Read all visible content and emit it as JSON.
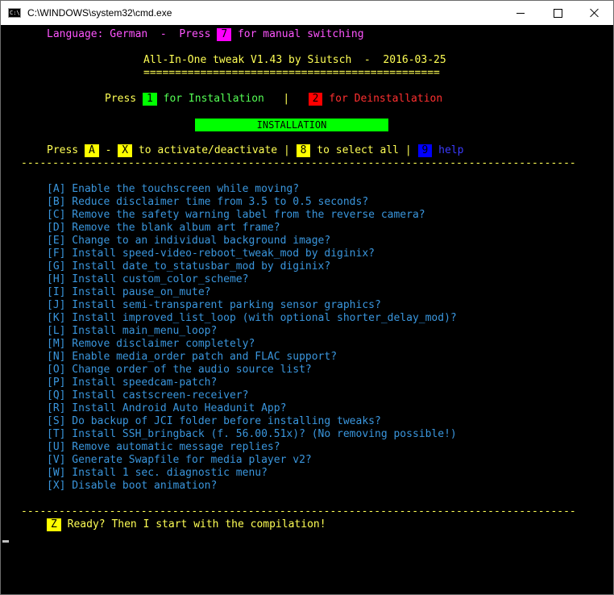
{
  "window": {
    "title": "C:\\WINDOWS\\system32\\cmd.exe",
    "icon_text": "C:\\"
  },
  "header": {
    "lang_prefix": "Language: German  -  Press ",
    "lang_key": "7",
    "lang_suffix": " for manual switching",
    "title": "All-In-One tweak V1.43 by Siutsch  -  2016-03-25",
    "underline": "==============================================="
  },
  "mode": {
    "press": "Press ",
    "install_key": "1",
    "install_label": " for Installation",
    "divider": "   |   ",
    "deinstall_key": "2",
    "deinstall_label": " for Deinstallation",
    "banner": "INSTALLATION"
  },
  "controls": {
    "press": "Press ",
    "key_a": "A",
    "dash": " - ",
    "key_x": "X",
    "activate_label": " to activate/deactivate ",
    "bar": "|",
    "key_8": "8",
    "select_all_label": " to select all ",
    "key_9": "9",
    "help_label": " help"
  },
  "separator": "----------------------------------------------------------------------------------------",
  "options": [
    "[A] Enable the touchscreen while moving?",
    "[B] Reduce disclaimer time from 3.5 to 0.5 seconds?",
    "[C] Remove the safety warning label from the reverse camera?",
    "[D] Remove the blank album art frame?",
    "[E] Change to an individual background image?",
    "[F] Install speed-video-reboot_tweak_mod by diginix?",
    "[G] Install date_to_statusbar_mod by diginix?",
    "[H] Install custom_color_scheme?",
    "[I] Install pause_on_mute?",
    "[J] Install semi-transparent parking sensor graphics?",
    "[K] Install improved_list_loop (with optional shorter_delay_mod)?",
    "[L] Install main_menu_loop?",
    "[M] Remove disclaimer completely?",
    "[N] Enable media_order patch and FLAC support?",
    "[O] Change order of the audio source list?",
    "[P] Install speedcam-patch?",
    "[Q] Install castscreen-receiver?",
    "[R] Install Android Auto Headunit App?",
    "[S] Do backup of JCI folder before installing tweaks?",
    "[T] Install SSH_bringback (f. 56.00.51x)? (No removing possible!)",
    "[U] Remove automatic message replies?",
    "[V] Generate Swapfile for media player v2?",
    "[W] Install 1 sec. diagnostic menu?",
    "[X] Disable boot animation?"
  ],
  "footer": {
    "key_z": "Z",
    "ready_text": " Ready? Then I start with the compilation!"
  },
  "colors": {
    "magenta": "#ff00ff",
    "green": "#00ff00",
    "red": "#ff0000",
    "yellow": "#ffff00",
    "blue": "#0000ff",
    "option_text": "#3a96dd"
  }
}
